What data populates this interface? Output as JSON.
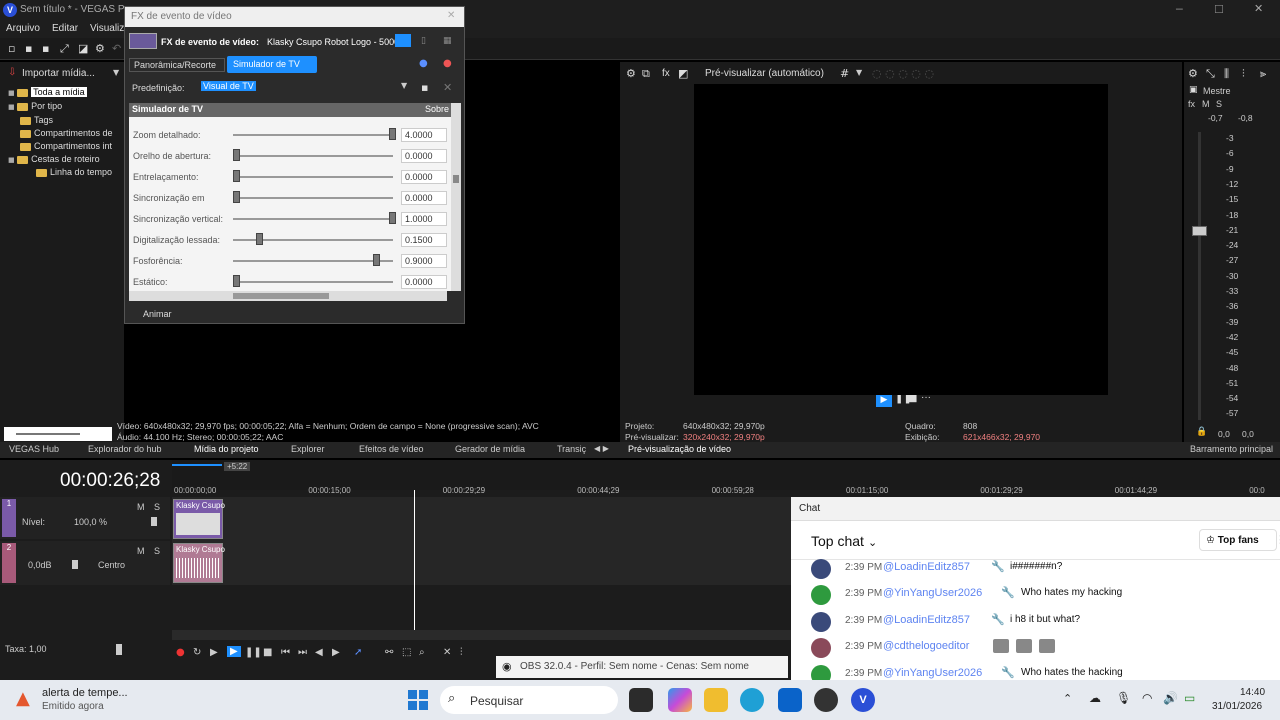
{
  "window": {
    "title": "Sem título * - VEGAS Pro"
  },
  "menu": [
    "Arquivo",
    "Editar",
    "Visualiz"
  ],
  "explorer": {
    "import_label": "Importar mídia...",
    "tree": [
      "Toda a mídia",
      "Por tipo",
      "Tags",
      "Compartimentos de",
      "Compartimentos int",
      "Cestas de roteiro",
      "Linha do tempo"
    ]
  },
  "fx_dialog": {
    "header": "FX de evento de vídeo",
    "title_label": "FX de evento de vídeo:",
    "title_value": "Klasky Csupo Robot Logo - 5000",
    "chain": [
      "Panorâmica/Recorte",
      "Simulador de TV"
    ],
    "preset_label": "Predefinição:",
    "preset_value": "Visual de TV",
    "section": "Simulador de TV",
    "section_right": "Sobre",
    "params": [
      {
        "label": "Zoom detalhado:",
        "value": "4.0000",
        "level": 1.0
      },
      {
        "label": "Orelho de abertura:",
        "value": "0.0000",
        "level": 0.0
      },
      {
        "label": "Entrelaçamento:",
        "value": "0.0000",
        "level": 0.0
      },
      {
        "label": "Sincronização em",
        "value": "0.0000",
        "level": 0.0
      },
      {
        "label": "Sincronização vertical:",
        "value": "1.0000",
        "level": 1.0
      },
      {
        "label": "Digitalização lessada:",
        "value": "0.1500",
        "level": 0.15
      },
      {
        "label": "Fosforência:",
        "value": "0.9000",
        "level": 0.9
      },
      {
        "label": "Estático:",
        "value": "0.0000",
        "level": 0.0
      }
    ],
    "animate": "Animar"
  },
  "media_info": {
    "line1": "Vídeo: 640x480x32; 29,970 fps; 00:00:05;22; Alfa = Nenhum; Ordem de campo = None (progressive scan); AVC",
    "line2": "Áudio: 44.100 Hz; Stereo; 00:00:05;22; AAC"
  },
  "preview": {
    "mode": "Pré-visualizar (automático)",
    "project_label": "Projeto:",
    "project_value": "640x480x32; 29,970p",
    "prerender_label": "Pré-visualizar:",
    "prerender_value": "320x240x32; 29,970p",
    "frame_label": "Quadro:",
    "frame_value": "808",
    "display_label": "Exibição:",
    "display_value": "621x466x32; 29,970"
  },
  "meter": {
    "master": "Mestre",
    "m": "M",
    "s": "S",
    "peak_left": "-0,7",
    "peak_right": "-0,8",
    "scale": [
      "-3",
      "-6",
      "-9",
      "-12",
      "-15",
      "-18",
      "-21",
      "-24",
      "-27",
      "-30",
      "-33",
      "-36",
      "-39",
      "-42",
      "-45",
      "-48",
      "-51",
      "-54",
      "-57"
    ],
    "bottom_left": "0,0",
    "bottom_right": "0,0",
    "bus": "Barramento principal"
  },
  "tabs": [
    "VEGAS Hub",
    "Explorador do hub",
    "Mídia do projeto",
    "Explorer",
    "Efeitos de vídeo",
    "Gerador de mídia",
    "Transiç",
    "Pré-visualização de vídeo"
  ],
  "timeline": {
    "timecode": "00:00:26;28",
    "marker_label": "+5:22",
    "ruler": [
      "00:00:00;00",
      "00:00:15;00",
      "00:00:29;29",
      "00:00:44;29",
      "00:00:59;28",
      "00:01:15;00",
      "00:01:29;29",
      "00:01:44;29",
      "00:0"
    ],
    "video_track": {
      "num": "1",
      "level_label": "Nível:",
      "level_value": "100,0 %",
      "m": "M",
      "s": "S"
    },
    "audio_track": {
      "num": "2",
      "vol": "0,0dB",
      "pan": "Centro",
      "m": "M",
      "s": "S"
    },
    "clip_label": "Klasky Csupo",
    "rate_label": "Taxa: 1,00"
  },
  "obs": {
    "label": "OBS 32.0.4 - Perfil: Sem nome - Cenas: Sem nome"
  },
  "chat": {
    "header": "Chat",
    "mode": "Top chat",
    "top_fans": "Top fans",
    "messages": [
      {
        "time": "2:39 PM",
        "author": "@LoadinEditz857",
        "text": "i#######n?"
      },
      {
        "time": "2:39 PM",
        "author": "@YinYangUser2026",
        "text": "Who hates my hacking"
      },
      {
        "time": "2:39 PM",
        "author": "@LoadinEditz857",
        "text": "i h8 it but what?"
      },
      {
        "time": "2:39 PM",
        "author": "@cdthelogoeditor",
        "text": ""
      },
      {
        "time": "2:39 PM",
        "author": "@YinYangUser2026",
        "text": "Who hates the hacking"
      }
    ]
  },
  "taskbar": {
    "notification_title": "alerta de tempe...",
    "notification_sub": "Emitido agora",
    "search": "Pesquisar",
    "time": "14:40",
    "date": "31/01/2026"
  },
  "colors": {
    "accent": "#1e90ff",
    "chat_author": "#5e84f1",
    "vegas_blue": "#2a4fd6"
  }
}
